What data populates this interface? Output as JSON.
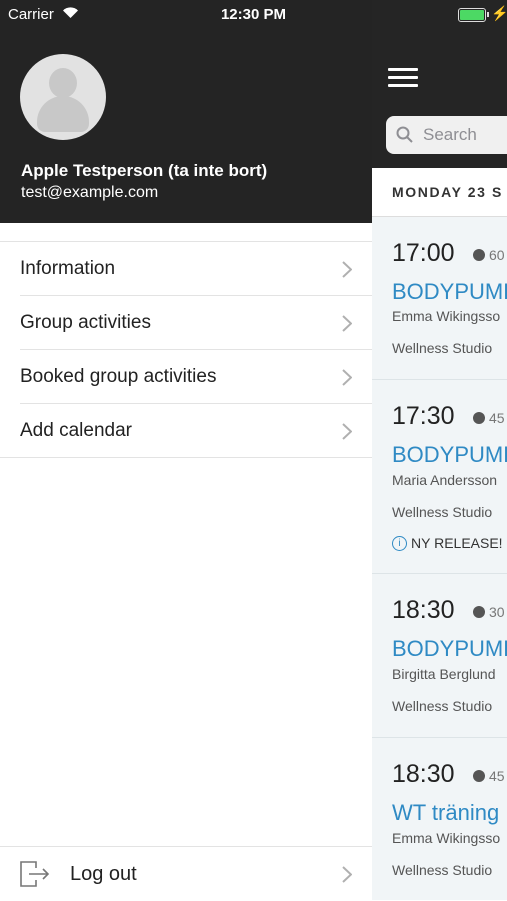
{
  "status_bar": {
    "carrier": "Carrier",
    "time": "12:30 PM"
  },
  "profile": {
    "name": "Apple Testperson (ta inte bort)",
    "email": "test@example.com"
  },
  "menu": {
    "items": [
      {
        "label": "Information"
      },
      {
        "label": "Group activities"
      },
      {
        "label": "Booked group activities"
      },
      {
        "label": "Add calendar"
      }
    ],
    "logout_label": "Log out"
  },
  "main": {
    "search_placeholder": "Search",
    "day_header": "MONDAY 23 S",
    "cards": [
      {
        "time": "17:00",
        "duration": "60",
        "name": "BODYPUMP",
        "instructor": "Emma Wikingsso",
        "location": "Wellness Studio"
      },
      {
        "time": "17:30",
        "duration": "45",
        "name": "BODYPUMP",
        "instructor": "Maria Andersson",
        "location": "Wellness Studio",
        "note": "NY RELEASE!"
      },
      {
        "time": "18:30",
        "duration": "30",
        "name": "BODYPUMP",
        "instructor": "Birgitta Berglund",
        "location": "Wellness Studio"
      },
      {
        "time": "18:30",
        "duration": "45",
        "name": "WT träning",
        "instructor": "Emma Wikingsso",
        "location": "Wellness Studio"
      }
    ]
  },
  "colors": {
    "header_bg": "#242424",
    "accent": "#2f8ac4",
    "battery": "#4cd964"
  }
}
